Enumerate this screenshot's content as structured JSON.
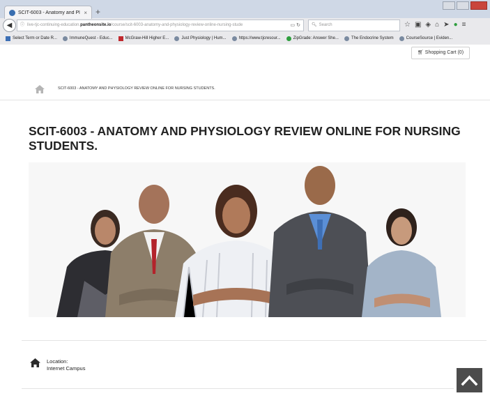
{
  "browser": {
    "tab_title": "SCIT-6003 - Anatomy and Pl",
    "tab_close": "×",
    "new_tab": "+",
    "url_prefix": "live-tjc-continuing-education.",
    "url_host": "pantheonsite.io",
    "url_path": "/course/scit-6003-anatomy-and-physiology-review-online-nursing-stude",
    "search_placeholder": "Search",
    "bookmarks": [
      {
        "label": "Select Term or Date R...",
        "icon": "bookmark-icon"
      },
      {
        "label": "ImmuneQuest - Educ...",
        "icon": "site-icon"
      },
      {
        "label": "McGraw-Hill Higher E...",
        "icon": "mcgraw-hill-icon"
      },
      {
        "label": "Just Physiology | Hum...",
        "icon": "site-icon"
      },
      {
        "label": "https://www.tjcresour...",
        "icon": "site-icon"
      },
      {
        "label": "ZipGrade: Answer She...",
        "icon": "check-icon"
      },
      {
        "label": "The Endocrine System",
        "icon": "site-icon"
      },
      {
        "label": "CourseSource | Eviden...",
        "icon": "site-icon"
      }
    ]
  },
  "header": {
    "cart_label": "Shopping Cart (0)"
  },
  "breadcrumb": {
    "current": "SCIT-6003 - ANATOMY AND PHYSIOLOGY REVIEW ONLINE FOR NURSING STUDENTS."
  },
  "course": {
    "title": "SCIT-6003 - ANATOMY AND PHYSIOLOGY REVIEW ONLINE FOR NURSING STUDENTS.",
    "location_label": "Location:",
    "location_value": "Internet Campus"
  },
  "colors": {
    "scroll_top_bg": "#4c4c4c",
    "title_text": "#222222"
  }
}
